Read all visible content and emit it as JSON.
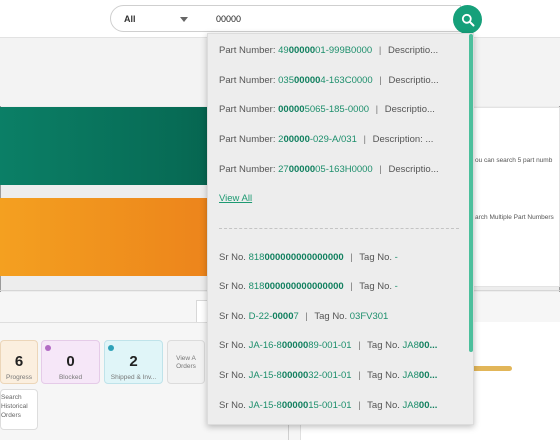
{
  "search": {
    "scope_label": "All",
    "query": "00000"
  },
  "right_panel": {
    "hint_text": "ou can search 5 part numb",
    "multi_label": "arch Multiple Part Numbers"
  },
  "status_cards": {
    "in_progress": {
      "count": "6",
      "label": "Progress"
    },
    "blocked": {
      "count": "0",
      "label": "Blocked"
    },
    "shipped": {
      "count": "2",
      "label": "Shipped & Inv..."
    },
    "view_all": {
      "label_line1": "View A",
      "label_line2": "Orders"
    },
    "historical": {
      "line1": "Search",
      "line2": "Historical",
      "line3": "Orders"
    }
  },
  "colors": {
    "accent": "#16a07a",
    "match_highlight": "#11805f",
    "banner_green": "#0b7f66",
    "banner_orange": "#f4a020"
  },
  "dropdown": {
    "part_number_label": "Part Number:",
    "description_label": "Descriptio...",
    "description_label_full": "Description: ...",
    "sr_label": "Sr No.",
    "tag_label": "Tag No.",
    "view_all_label": "View All",
    "parts": [
      {
        "pre": "49",
        "hl": "00000",
        "post": "01-999B0000",
        "desc": "Descriptio..."
      },
      {
        "pre": "035",
        "hl": "00000",
        "post": "4-163C0000",
        "desc": "Descriptio..."
      },
      {
        "pre": "",
        "hl": "00000",
        "post": "5065-185-0000",
        "desc": "Descriptio..."
      },
      {
        "pre": "2",
        "hl": "00000",
        "post": "-029-A/031",
        "desc": "Description: ..."
      },
      {
        "pre": "27",
        "hl": "00000",
        "post": "05-163H0000",
        "desc": "Descriptio..."
      }
    ],
    "serials": [
      {
        "pre": "818",
        "hl": "000000000000000",
        "post": "",
        "tag_pre": "-",
        "tag_hl": "",
        "tag_post": ""
      },
      {
        "pre": "818",
        "hl": "000000000000000",
        "post": "",
        "tag_pre": "-",
        "tag_hl": "",
        "tag_post": ""
      },
      {
        "pre": "D-22-",
        "hl": "0000",
        "post": "7",
        "tag_pre": "03FV301",
        "tag_hl": "",
        "tag_post": ""
      },
      {
        "pre": "JA-16-8",
        "hl": "00000",
        "post": "89-001-01",
        "tag_pre": "JA8",
        "tag_hl": "00...",
        "tag_post": ""
      },
      {
        "pre": "JA-15-8",
        "hl": "00000",
        "post": "32-001-01",
        "tag_pre": "JA8",
        "tag_hl": "00...",
        "tag_post": ""
      },
      {
        "pre": "JA-15-8",
        "hl": "00000",
        "post": "15-001-01",
        "tag_pre": "JA8",
        "tag_hl": "00...",
        "tag_post": ""
      }
    ]
  }
}
